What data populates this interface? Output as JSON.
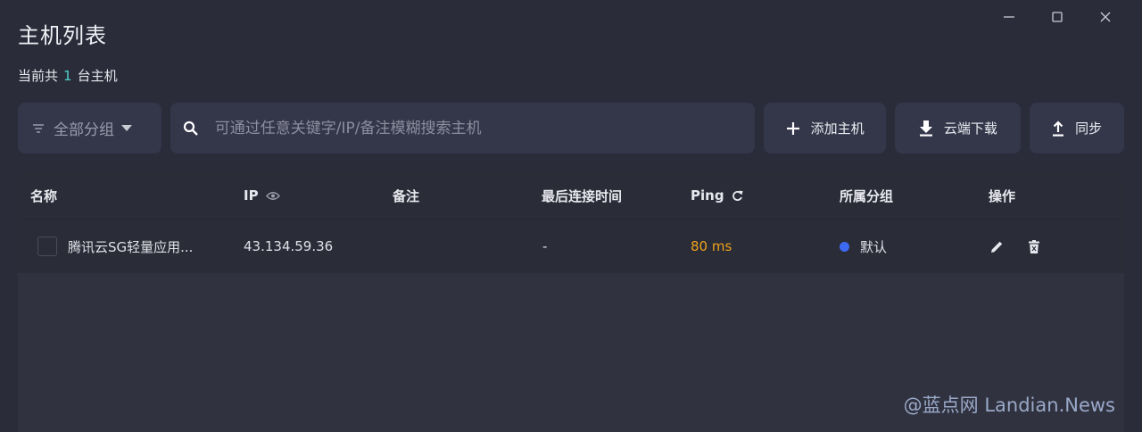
{
  "window": {
    "title": "主机列表"
  },
  "summary": {
    "prefix": "当前共",
    "count": "1",
    "suffix": "台主机"
  },
  "toolbar": {
    "group_label": "全部分组",
    "search_placeholder": "可通过任意关键字/IP/备注模糊搜索主机",
    "add_label": "添加主机",
    "download_label": "云端下载",
    "sync_label": "同步"
  },
  "table": {
    "headers": {
      "name": "名称",
      "ip": "IP",
      "remark": "备注",
      "last_conn": "最后连接时间",
      "ping": "Ping",
      "group": "所属分组",
      "ops": "操作"
    },
    "rows": [
      {
        "name": "腾讯云SG轻量应用...",
        "ip": "43.134.59.36",
        "remark": "",
        "last_conn": "-",
        "ping": "80 ms",
        "group": "默认"
      }
    ]
  },
  "watermark": "@蓝点网 Landian.News",
  "colors": {
    "accent": "#4fd1c5",
    "ping": "#f0a21a",
    "group_dot": "#3d6af2"
  }
}
